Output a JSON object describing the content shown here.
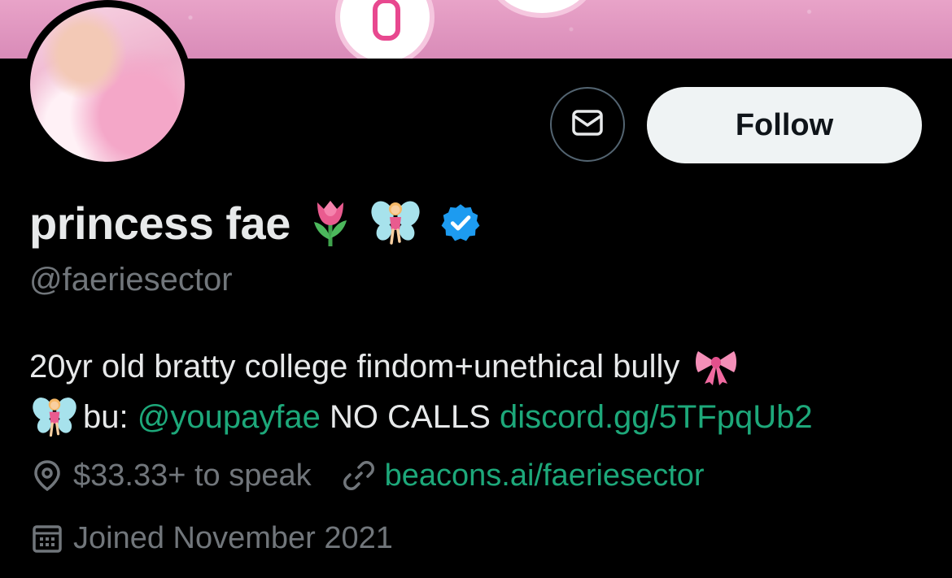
{
  "profile": {
    "display_name": "princess fae",
    "handle": "@faeriesector",
    "verified": true,
    "follow_label": "Follow"
  },
  "bio": {
    "line1_text": "20yr old bratty college findom+unethical bully",
    "line2_prefix": "bu: ",
    "line2_mention": "@youpayfae",
    "line2_middle": " NO CALLS ",
    "line2_link": "discord.gg/5TFpqUb2"
  },
  "meta": {
    "location": "$33.33+ to speak",
    "website": "beacons.ai/faeriesector",
    "joined": "Joined November 2021"
  },
  "icons": {
    "message": "envelope-icon",
    "verified": "verified-badge-icon",
    "location": "location-pin-icon",
    "link": "link-icon",
    "calendar": "calendar-icon",
    "emoji_1": "tulip-emoji-icon",
    "emoji_2": "fairy-emoji-icon",
    "emoji_3": "ribbon-emoji-icon"
  },
  "colors": {
    "background": "#000000",
    "link": "#1da87a",
    "secondary_text": "#71767b",
    "verified_blue": "#1d9bf0",
    "follow_bg": "#eff3f4"
  }
}
